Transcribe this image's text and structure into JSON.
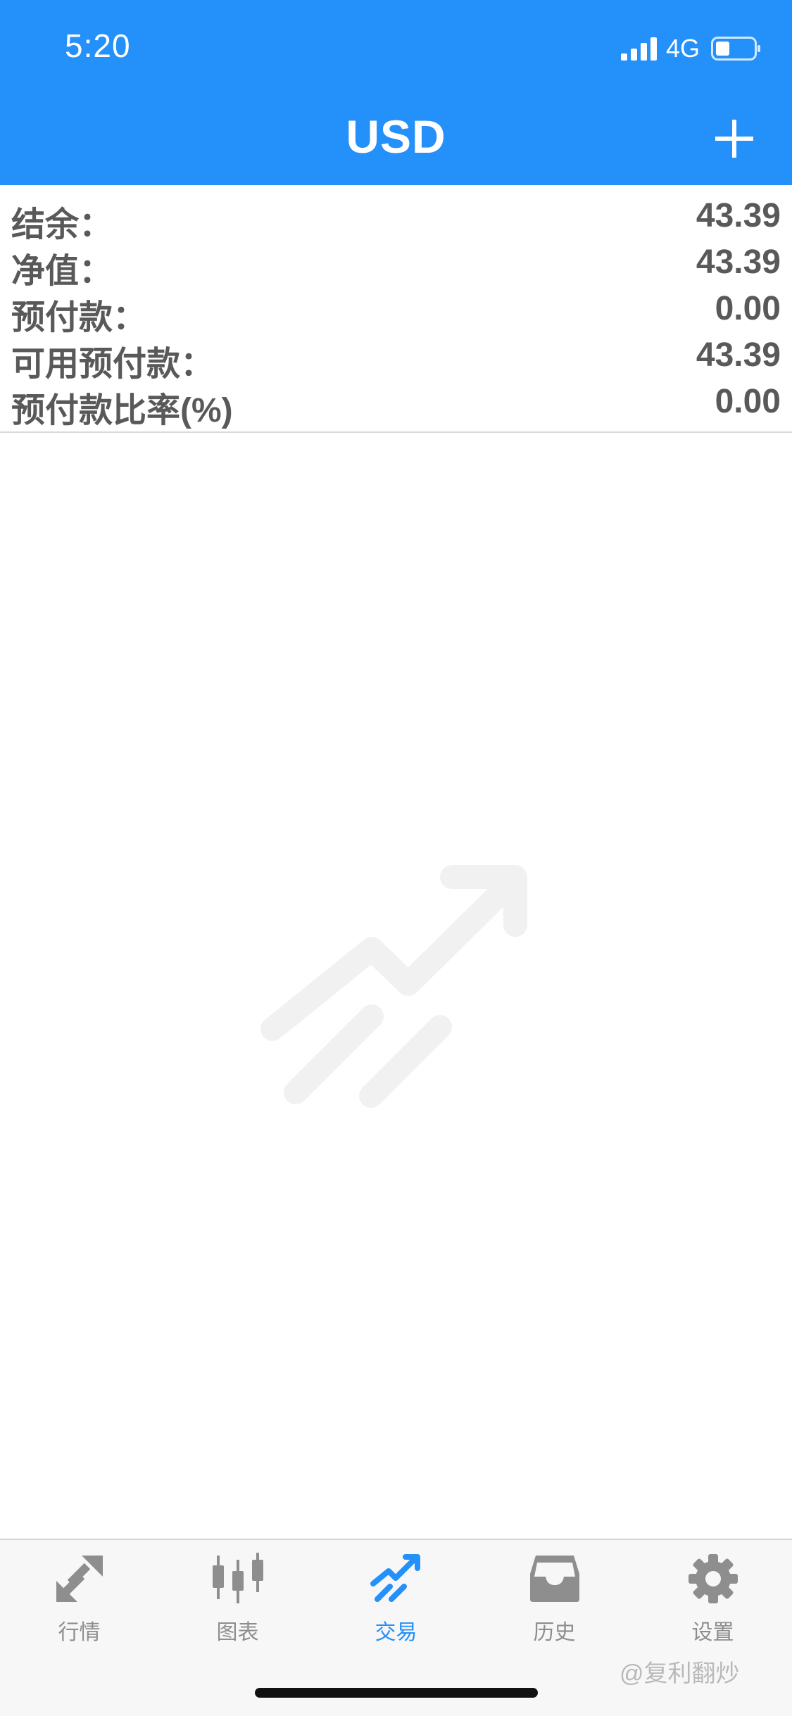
{
  "status_bar": {
    "time": "5:20",
    "network": "4G"
  },
  "nav": {
    "title": "USD",
    "add_icon": "plus-icon"
  },
  "account": [
    {
      "label": "结余：",
      "value": "43.39"
    },
    {
      "label": "净值：",
      "value": "43.39"
    },
    {
      "label": "预付款：",
      "value": "0.00"
    },
    {
      "label": "可用预付款：",
      "value": "43.39"
    },
    {
      "label": "预付款比率(%)",
      "value": "0.00"
    }
  ],
  "empty_state": {
    "icon": "trending-up-icon"
  },
  "tabs": [
    {
      "label": "行情",
      "icon": "quotes-icon",
      "active": false
    },
    {
      "label": "图表",
      "icon": "candlestick-icon",
      "active": false
    },
    {
      "label": "交易",
      "icon": "trade-icon",
      "active": true
    },
    {
      "label": "历史",
      "icon": "inbox-icon",
      "active": false
    },
    {
      "label": "设置",
      "icon": "gear-icon",
      "active": false
    }
  ],
  "watermark": "@复利翻炒",
  "colors": {
    "header": "#2490fa",
    "accent": "#2490fa",
    "text": "#595959",
    "inactive": "#8e8e8e"
  }
}
